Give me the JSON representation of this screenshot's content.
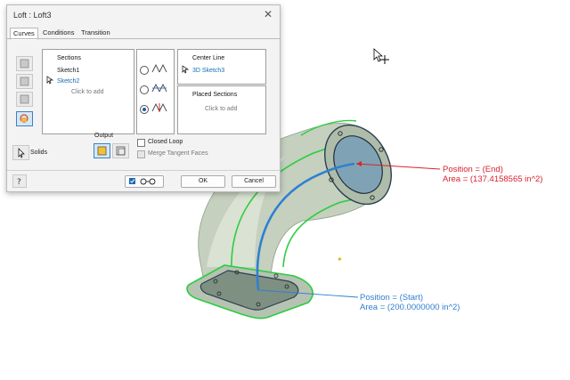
{
  "dialog": {
    "title": "Loft : Loft3",
    "tabs": [
      "Curves",
      "Conditions",
      "Transition"
    ],
    "sections": {
      "header": "Sections",
      "items": [
        "Sketch1",
        "Sketch2"
      ],
      "hint": "Click to add"
    },
    "center_line": {
      "header": "Center Line",
      "item": "3D Sketch3"
    },
    "placed_sections": {
      "header": "Placed Sections",
      "hint": "Click to add"
    },
    "solids_label": "Solids",
    "output_label": "Output",
    "closed_loop_label": "Closed Loop",
    "merge_tangent_label": "Merge Tangent Faces",
    "ok_label": "OK",
    "cancel_label": "Cancel",
    "icons": [
      "close-icon",
      "cursor-icon",
      "help-icon",
      "preview-glasses-icon",
      "solid-output-icon",
      "surface-output-icon"
    ]
  },
  "annotations": {
    "end_position": "Position = (End)",
    "end_area": "Area = (137.4158565 in^2)",
    "start_position": "Position = (Start)",
    "start_area": "Area = (200.0000000 in^2)"
  },
  "colors": {
    "end_annotation": "#d9232e",
    "start_annotation": "#2f7fd0",
    "loft_surface": "#c9d4c2",
    "rail_highlight": "#2ecc40",
    "center_line": "#2f80d0",
    "accent": "#1a6bb3"
  }
}
